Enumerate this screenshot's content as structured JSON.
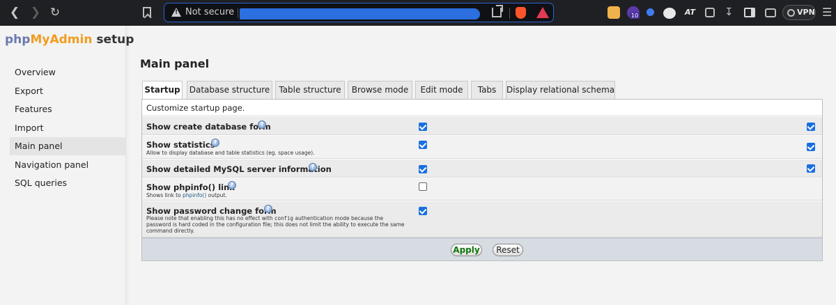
{
  "browser": {
    "url_security_label": "Not secure",
    "vpn_label": "VPN",
    "extension_badge_count": "10",
    "extension_text": "AT"
  },
  "sidebar": {
    "logo": {
      "part1": "php",
      "part2": "MyAdmin",
      "part3": " setup"
    },
    "items": [
      {
        "label": "Overview"
      },
      {
        "label": "Export"
      },
      {
        "label": "Features"
      },
      {
        "label": "Import"
      },
      {
        "label": "Main panel",
        "active": true
      },
      {
        "label": "Navigation panel"
      },
      {
        "label": "SQL queries"
      }
    ]
  },
  "main": {
    "title": "Main panel",
    "tabs": [
      {
        "label": "Startup",
        "active": true
      },
      {
        "label": "Database structure"
      },
      {
        "label": "Table structure"
      },
      {
        "label": "Browse mode"
      },
      {
        "label": "Edit mode"
      },
      {
        "label": "Tabs"
      },
      {
        "label": "Display relational schema"
      }
    ],
    "description": "Customize startup page.",
    "rows": [
      {
        "label": "Show create database form",
        "help": "?",
        "checked": true,
        "default_checked": true
      },
      {
        "label": "Show statistics",
        "help": "?",
        "sub": "Allow to display database and table statistics (eg. space usage).",
        "checked": true,
        "default_checked": true
      },
      {
        "label": "Show detailed MySQL server information",
        "help": "?",
        "checked": true,
        "default_checked": true
      },
      {
        "label": "Show phpinfo() link",
        "help": "?",
        "sub_pre": "Shows link to ",
        "sub_link": "phpinfo()",
        "sub_post": " output.",
        "checked": false
      },
      {
        "label": "Show password change form",
        "help": "?",
        "sub_line1_pre": "Please note that enabling this has no effect with ",
        "sub_code": "config",
        "sub_line1_post": " authentication mode because the",
        "sub_line2": "password is hard coded in the configuration file; this does not limit the ability to execute the same",
        "sub_line3": "command directly.",
        "checked": true
      }
    ],
    "buttons": {
      "apply": "Apply",
      "reset": "Reset"
    }
  },
  "colors": {
    "accent_check": "#1a6fe0",
    "apply_text": "#117711",
    "logo_php": "#6c78b0",
    "logo_myadmin": "#f29c1f"
  }
}
